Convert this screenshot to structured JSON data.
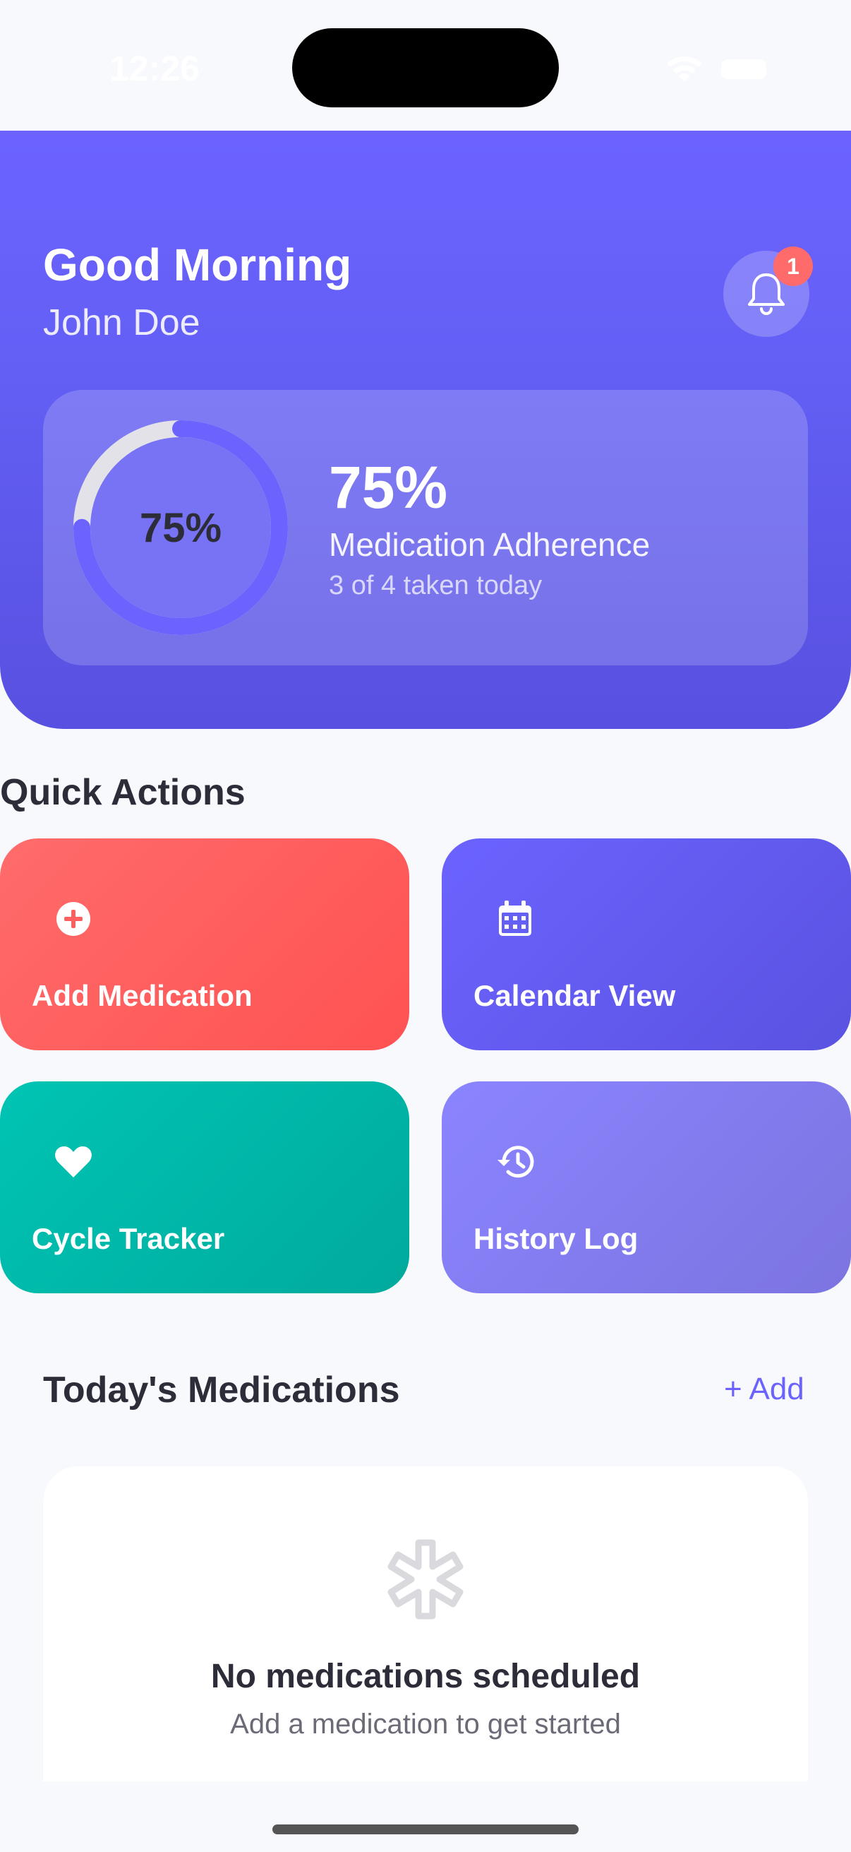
{
  "status_bar": {
    "time": "12:26"
  },
  "header": {
    "greeting": "Good Morning",
    "user_name": "John Doe",
    "notification_count": "1"
  },
  "adherence": {
    "ring_label": "75%",
    "percent": "75%",
    "label": "Medication Adherence",
    "summary": "3 of 4 taken today",
    "fraction": 0.75
  },
  "quick_actions": {
    "title": "Quick Actions",
    "items": [
      {
        "label": "Add Medication",
        "icon": "plus-circle-icon"
      },
      {
        "label": "Calendar View",
        "icon": "calendar-icon"
      },
      {
        "label": "Cycle Tracker",
        "icon": "heart-icon"
      },
      {
        "label": "History Log",
        "icon": "history-icon"
      }
    ]
  },
  "medications": {
    "title": "Today's Medications",
    "add_label": "+ Add",
    "empty_title": "No medications scheduled",
    "empty_subtitle": "Add a medication to get started",
    "empty_icon": "medical-asterisk-icon"
  },
  "colors": {
    "primary": "#6c63ff",
    "coral": "#ff6b6b",
    "teal": "#00c4b3",
    "lavender": "#8b84ff"
  }
}
